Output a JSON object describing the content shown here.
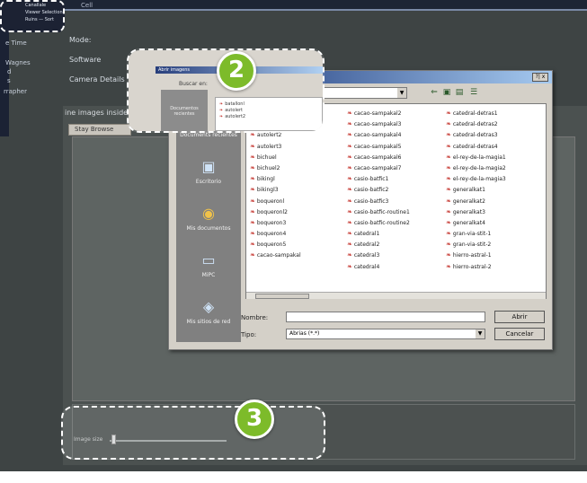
{
  "top_panel": {
    "items": [
      "Canallale",
      "Viewer Selection",
      "Ruins — Sort"
    ],
    "header_fragment": "Cell"
  },
  "left_nav": {
    "items": [
      "e Time",
      "Wagnes",
      "d",
      "s",
      "rrapher"
    ]
  },
  "side_labels": {
    "mode": "Mode:",
    "software": "Software",
    "camera": "Camera Details"
  },
  "main_panel": {
    "title": "ine images inside",
    "tab": "Stay Browse"
  },
  "bottom_bar": {
    "slider_label": "Image size",
    "slider_value_percent": 3
  },
  "dialog": {
    "title": "Abrir imagens",
    "look_in_label": "Buscar en:",
    "look_in_value": "",
    "close_label": "?| x",
    "places": [
      {
        "icon": "folder-icon",
        "label": "Documents recientes"
      },
      {
        "icon": "desktop-icon",
        "label": "Escritorio"
      },
      {
        "icon": "documents-icon",
        "label": "Mis documentos"
      },
      {
        "icon": "computer-icon",
        "label": "MiPC"
      },
      {
        "icon": "network-icon",
        "label": "Mis sitios de red"
      }
    ],
    "files_col1": [
      "batallonl",
      "autolert",
      "autolert2",
      "autolert3",
      "bichuel",
      "bichuel2",
      "bikingl",
      "bikingl3",
      "boqueronl",
      "boqueronl2",
      "boqueron3",
      "boqueron4",
      "boqueron5",
      "cacao-sampakal"
    ],
    "files_col2": [
      "cacao-sampakal2",
      "cacao-sampakal3",
      "cacao-sampakal4",
      "cacao-sampakal5",
      "cacao-sampakal6",
      "cacao-sampakal7",
      "casio-batfic1",
      "casio-batfic2",
      "casio-batfic3",
      "casio-batfic-routine1",
      "casio-batfic-routine2",
      "catedral1",
      "catedral2",
      "catedral3",
      "catedral4"
    ],
    "files_col3": [
      "catedral-detras1",
      "catedral-detras2",
      "catedral-detras3",
      "catedral-detras4",
      "el-rey-de-la-magia1",
      "el-rey-de-la-magia2",
      "el-rey-de-la-magia3",
      "generalkat1",
      "generalkat2",
      "generalkat3",
      "generalkat4",
      "gran-via-stit-1",
      "gran-via-stit-2",
      "hierro-astral-1",
      "hierro-astral-2"
    ],
    "filename_label": "Nombre:",
    "filename_value": "",
    "filetype_label": "Tipo:",
    "filetype_value": "Abrias (*.*)",
    "open_button": "Abrir",
    "cancel_button": "Cancelar"
  },
  "callout_zoom": {
    "title": "Abrir imagens",
    "look_in": "Buscar en:",
    "place_label": "Documentos recientes",
    "files": [
      "batallonl",
      "autolert",
      "autolert2"
    ]
  },
  "badges": {
    "step2": "2",
    "step3": "3"
  },
  "colors": {
    "badge_green": "#7dbb2a",
    "dialog_gray": "#d4d0c8",
    "app_bg": "#3e4444",
    "title_blue": "#0a246a"
  }
}
